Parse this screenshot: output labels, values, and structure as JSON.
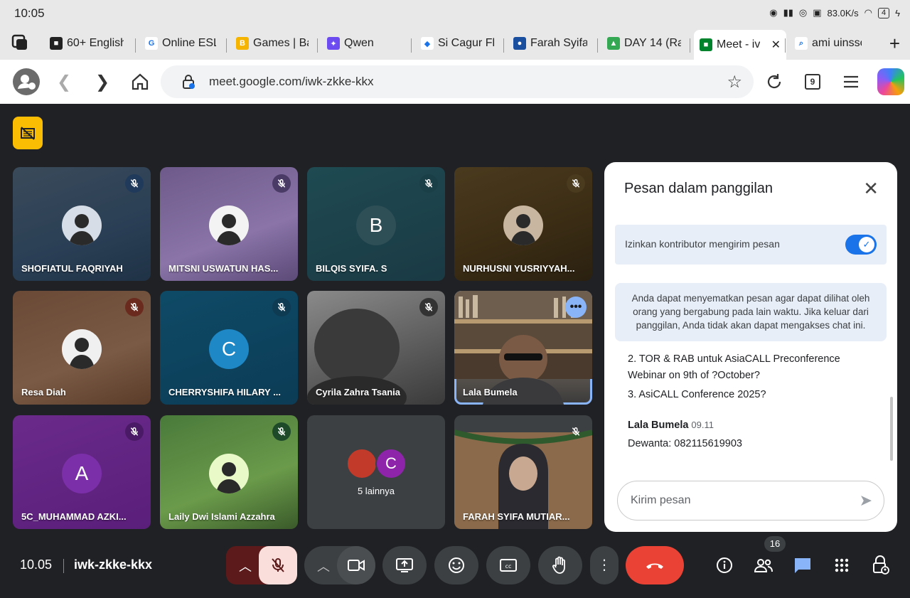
{
  "statusbar": {
    "time": "10:05",
    "net_speed": "83.0K/s",
    "battery": "4"
  },
  "tabs": [
    {
      "label": "60+ English",
      "fav_bg": "#222222",
      "fav_glyph": "■"
    },
    {
      "label": "Online ESL",
      "fav_bg": "#ffffff",
      "fav_glyph": "G"
    },
    {
      "label": "Games | Ba",
      "fav_bg": "#f4b400",
      "fav_glyph": "B"
    },
    {
      "label": "Qwen",
      "fav_bg": "#6c4cf1",
      "fav_glyph": "✦"
    },
    {
      "label": "Si Cagur Fl",
      "fav_bg": "#ffffff",
      "fav_glyph": "◆"
    },
    {
      "label": "Farah Syifa",
      "fav_bg": "#1a4fa0",
      "fav_glyph": "●"
    },
    {
      "label": "DAY 14 (Ra",
      "fav_bg": "#34a853",
      "fav_glyph": "▲"
    },
    {
      "label": "Meet - iv",
      "fav_bg": "#00832d",
      "fav_glyph": "■"
    },
    {
      "label": "ami uinssc",
      "fav_bg": "#ffffff",
      "fav_glyph": "⌕"
    }
  ],
  "address": {
    "url": "meet.google.com/iwk-zkke-kkx",
    "tab_count": "9"
  },
  "tiles": [
    {
      "name": "SHOFIATUL FAQRIYAH",
      "bg": "linear-gradient(160deg,#3a4a5a,#2a3f55 60%,#1f3246)",
      "avatar_bg": "#d7dde6",
      "avatar_text": "",
      "mute_bg": "#1f3a5a"
    },
    {
      "name": "MITSNI USWATUN HAS...",
      "bg": "linear-gradient(160deg,#6e5a8a,#8a74a8 60%,#5c4a78)",
      "avatar_bg": "#f3f3f3",
      "avatar_text": "",
      "mute_bg": "#4a3a66"
    },
    {
      "name": "BILQIS SYIFA. S",
      "bg": "linear-gradient(160deg,#1f4a52,#1a3a44)",
      "avatar_bg": "#2f4f56",
      "avatar_text": "B",
      "mute_bg": "#1b3f46"
    },
    {
      "name": "NURHUSNI YUSRIYYAH...",
      "bg": "linear-gradient(160deg,#4a3a1e,#3a2c14 60%,#2a2010)",
      "avatar_bg": "#c9b6a0",
      "avatar_text": "",
      "mute_bg": "#4a3a1e"
    },
    {
      "name": "Resa Diah",
      "bg": "linear-gradient(160deg,#6a4a36,#7a5a44 60%,#5a3c2a)",
      "avatar_bg": "#f0f0f0",
      "avatar_text": "",
      "mute_bg": "#6a2a1e"
    },
    {
      "name": "CHERRYSHIFA HILARY ...",
      "bg": "linear-gradient(160deg,#0e4a66,#0c3c56)",
      "avatar_bg": "#1e88c7",
      "avatar_text": "C",
      "mute_bg": "#0e3a52"
    },
    {
      "name": "Cyrila Zahra Tsania",
      "bg": "linear-gradient(160deg,#8a8a8a,#5a5a5a 60%,#3a3a3a)",
      "avatar_bg": "",
      "avatar_text": "",
      "mute_bg": "#333333"
    },
    {
      "name": "Lala Bumela",
      "bg": "linear-gradient(180deg,#6a5a4a 0%,#8a7a6a 35%,#3a3a3a 100%)",
      "avatar_bg": "",
      "avatar_text": "",
      "mute_bg": ""
    },
    {
      "name": "5C_MUHAMMAD AZKI...",
      "bg": "linear-gradient(160deg,#6a2a8a,#5a1f7a)",
      "avatar_bg": "#7b2fa8",
      "avatar_text": "A",
      "mute_bg": "#4a1a66"
    },
    {
      "name": "Laily Dwi Islami Azzahra",
      "bg": "linear-gradient(160deg,#4a7a3a,#6a9a4a 60%,#3a5a2a)",
      "avatar_bg": "#e9f9c8",
      "avatar_text": "",
      "mute_bg": "#1e4a2a"
    },
    {
      "name": "5 lainnya",
      "bg": "#3c4043",
      "avatar_bg": "",
      "avatar_text": "",
      "mute_bg": ""
    },
    {
      "name": "FARAH SYIFA MUTIAR...",
      "bg": "linear-gradient(180deg,#3c4043 0%,#3c4043 15%,#6a5a40 15%,#8a6a4a 60%,#4a3a2a 100%)",
      "avatar_bg": "",
      "avatar_text": "",
      "mute_bg": ""
    }
  ],
  "others": {
    "avatar2_letter": "C"
  },
  "chat": {
    "title": "Pesan dalam panggilan",
    "toggle_label": "Izinkan kontributor mengirim pesan",
    "info": "Anda dapat menyematkan pesan agar dapat dilihat oleh orang yang bergabung pada lain waktu. Jika keluar dari panggilan, Anda tidak akan dapat mengakses chat ini.",
    "msg_line1": "2. TOR & RAB untuk AsiaCALL Preconference",
    "msg_line2": "Webinar on 9th of ?October?",
    "msg_line3": "3. AsiCALL Conference 2025?",
    "sender": "Lala Bumela",
    "sender_time": "09.11",
    "msg_last": "Dewanta: 082115619903",
    "input_placeholder": "Kirim pesan"
  },
  "bottom": {
    "clock": "10.05",
    "meeting_code": "iwk-zkke-kkx",
    "participants_count": "16"
  }
}
